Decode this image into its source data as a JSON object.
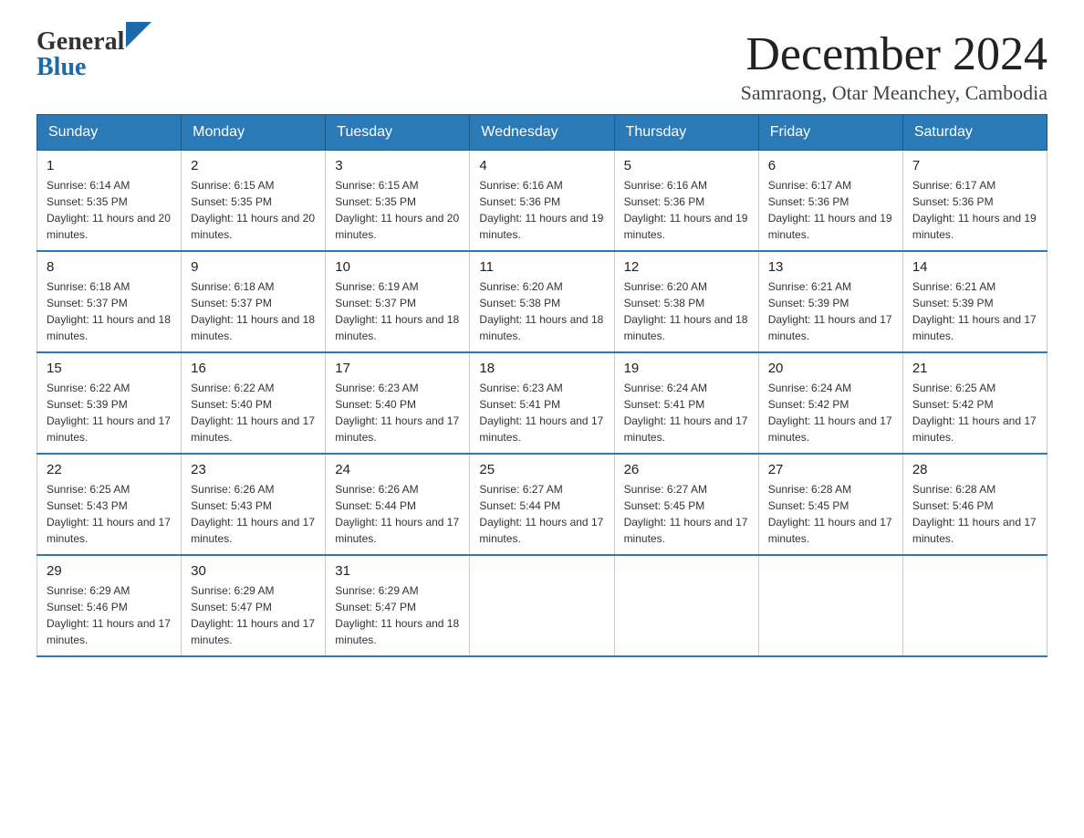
{
  "logo": {
    "general": "General",
    "blue": "Blue"
  },
  "title": "December 2024",
  "subtitle": "Samraong, Otar Meanchey, Cambodia",
  "days_of_week": [
    "Sunday",
    "Monday",
    "Tuesday",
    "Wednesday",
    "Thursday",
    "Friday",
    "Saturday"
  ],
  "weeks": [
    [
      {
        "day": "1",
        "sunrise": "6:14 AM",
        "sunset": "5:35 PM",
        "daylight": "11 hours and 20 minutes."
      },
      {
        "day": "2",
        "sunrise": "6:15 AM",
        "sunset": "5:35 PM",
        "daylight": "11 hours and 20 minutes."
      },
      {
        "day": "3",
        "sunrise": "6:15 AM",
        "sunset": "5:35 PM",
        "daylight": "11 hours and 20 minutes."
      },
      {
        "day": "4",
        "sunrise": "6:16 AM",
        "sunset": "5:36 PM",
        "daylight": "11 hours and 19 minutes."
      },
      {
        "day": "5",
        "sunrise": "6:16 AM",
        "sunset": "5:36 PM",
        "daylight": "11 hours and 19 minutes."
      },
      {
        "day": "6",
        "sunrise": "6:17 AM",
        "sunset": "5:36 PM",
        "daylight": "11 hours and 19 minutes."
      },
      {
        "day": "7",
        "sunrise": "6:17 AM",
        "sunset": "5:36 PM",
        "daylight": "11 hours and 19 minutes."
      }
    ],
    [
      {
        "day": "8",
        "sunrise": "6:18 AM",
        "sunset": "5:37 PM",
        "daylight": "11 hours and 18 minutes."
      },
      {
        "day": "9",
        "sunrise": "6:18 AM",
        "sunset": "5:37 PM",
        "daylight": "11 hours and 18 minutes."
      },
      {
        "day": "10",
        "sunrise": "6:19 AM",
        "sunset": "5:37 PM",
        "daylight": "11 hours and 18 minutes."
      },
      {
        "day": "11",
        "sunrise": "6:20 AM",
        "sunset": "5:38 PM",
        "daylight": "11 hours and 18 minutes."
      },
      {
        "day": "12",
        "sunrise": "6:20 AM",
        "sunset": "5:38 PM",
        "daylight": "11 hours and 18 minutes."
      },
      {
        "day": "13",
        "sunrise": "6:21 AM",
        "sunset": "5:39 PM",
        "daylight": "11 hours and 17 minutes."
      },
      {
        "day": "14",
        "sunrise": "6:21 AM",
        "sunset": "5:39 PM",
        "daylight": "11 hours and 17 minutes."
      }
    ],
    [
      {
        "day": "15",
        "sunrise": "6:22 AM",
        "sunset": "5:39 PM",
        "daylight": "11 hours and 17 minutes."
      },
      {
        "day": "16",
        "sunrise": "6:22 AM",
        "sunset": "5:40 PM",
        "daylight": "11 hours and 17 minutes."
      },
      {
        "day": "17",
        "sunrise": "6:23 AM",
        "sunset": "5:40 PM",
        "daylight": "11 hours and 17 minutes."
      },
      {
        "day": "18",
        "sunrise": "6:23 AM",
        "sunset": "5:41 PM",
        "daylight": "11 hours and 17 minutes."
      },
      {
        "day": "19",
        "sunrise": "6:24 AM",
        "sunset": "5:41 PM",
        "daylight": "11 hours and 17 minutes."
      },
      {
        "day": "20",
        "sunrise": "6:24 AM",
        "sunset": "5:42 PM",
        "daylight": "11 hours and 17 minutes."
      },
      {
        "day": "21",
        "sunrise": "6:25 AM",
        "sunset": "5:42 PM",
        "daylight": "11 hours and 17 minutes."
      }
    ],
    [
      {
        "day": "22",
        "sunrise": "6:25 AM",
        "sunset": "5:43 PM",
        "daylight": "11 hours and 17 minutes."
      },
      {
        "day": "23",
        "sunrise": "6:26 AM",
        "sunset": "5:43 PM",
        "daylight": "11 hours and 17 minutes."
      },
      {
        "day": "24",
        "sunrise": "6:26 AM",
        "sunset": "5:44 PM",
        "daylight": "11 hours and 17 minutes."
      },
      {
        "day": "25",
        "sunrise": "6:27 AM",
        "sunset": "5:44 PM",
        "daylight": "11 hours and 17 minutes."
      },
      {
        "day": "26",
        "sunrise": "6:27 AM",
        "sunset": "5:45 PM",
        "daylight": "11 hours and 17 minutes."
      },
      {
        "day": "27",
        "sunrise": "6:28 AM",
        "sunset": "5:45 PM",
        "daylight": "11 hours and 17 minutes."
      },
      {
        "day": "28",
        "sunrise": "6:28 AM",
        "sunset": "5:46 PM",
        "daylight": "11 hours and 17 minutes."
      }
    ],
    [
      {
        "day": "29",
        "sunrise": "6:29 AM",
        "sunset": "5:46 PM",
        "daylight": "11 hours and 17 minutes."
      },
      {
        "day": "30",
        "sunrise": "6:29 AM",
        "sunset": "5:47 PM",
        "daylight": "11 hours and 17 minutes."
      },
      {
        "day": "31",
        "sunrise": "6:29 AM",
        "sunset": "5:47 PM",
        "daylight": "11 hours and 18 minutes."
      },
      null,
      null,
      null,
      null
    ]
  ]
}
